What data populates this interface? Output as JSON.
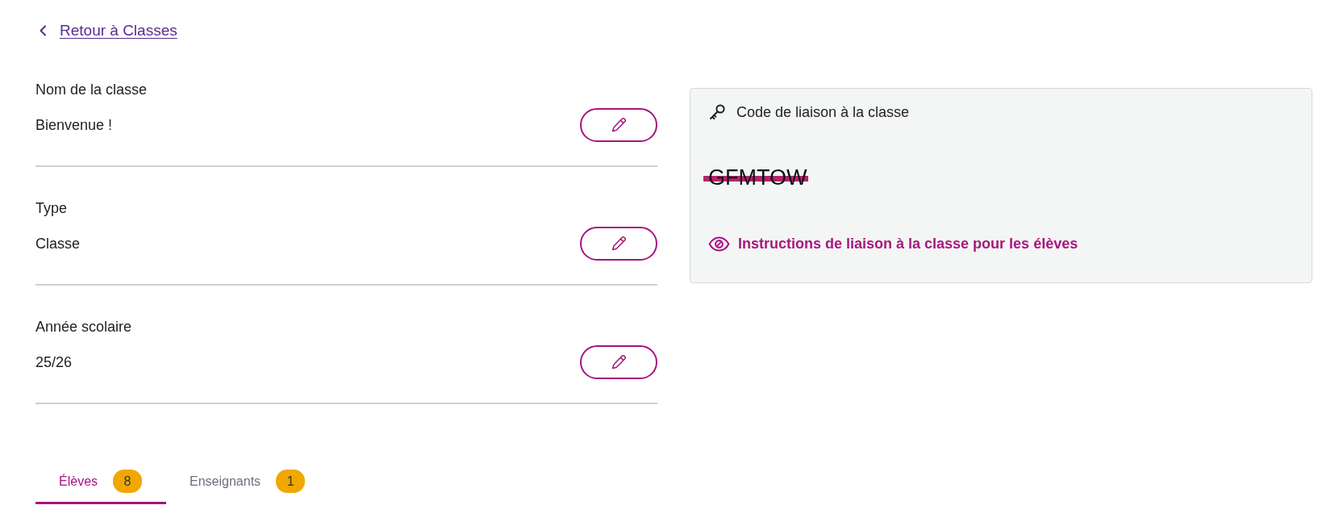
{
  "back_link": {
    "label": "Retour à Classes"
  },
  "fields": [
    {
      "label": "Nom de la classe",
      "value": "Bienvenue !"
    },
    {
      "label": "Type",
      "value": "Classe"
    },
    {
      "label": "Année scolaire",
      "value": "25/26"
    }
  ],
  "join_code_card": {
    "title": "Code de liaison à la classe",
    "code": "GFMTOW",
    "redacted": true,
    "instructions_link": "Instructions de liaison à la classe pour les élèves"
  },
  "tabs": [
    {
      "label": "Élèves",
      "count": "8",
      "selected": true
    },
    {
      "label": "Enseignants",
      "count": "1",
      "selected": false
    }
  ]
}
